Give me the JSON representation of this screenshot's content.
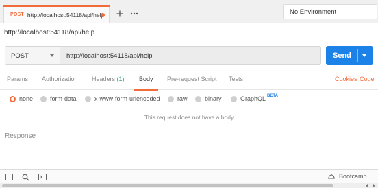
{
  "request_tab": {
    "method": "POST",
    "url": "http://localhost:54118/api/help",
    "unsaved_color": "#f26b3a"
  },
  "tab_actions": {
    "add_icon": "plus-icon",
    "more_icon": "ellipsis-icon"
  },
  "environment": {
    "selected": "No Environment"
  },
  "request": {
    "title": "http://localhost:54118/api/help",
    "method": "POST",
    "url": "http://localhost:54118/api/help",
    "send_label": "Send"
  },
  "request_tabs": {
    "params": "Params",
    "authorization": "Authorization",
    "headers": "Headers",
    "headers_count": "(1)",
    "body": "Body",
    "prerequest": "Pre-request Script",
    "tests": "Tests",
    "cookies": "Cookies",
    "code": "Code",
    "active": "Body"
  },
  "body_types": {
    "none": "none",
    "form_data": "form-data",
    "urlencoded": "x-www-form-urlencoded",
    "raw": "raw",
    "binary": "binary",
    "graphql": "GraphQL",
    "graphql_badge": "BETA",
    "selected": "none"
  },
  "body_message": "This request does not have a body",
  "response": {
    "label": "Response"
  },
  "statusbar": {
    "icons": [
      "sidebar-icon",
      "search-icon",
      "console-icon"
    ],
    "bootcamp_label": "Bootcamp"
  },
  "colors": {
    "accent": "#f26b3a",
    "send": "#1d82e8",
    "success": "#2aaa6c"
  }
}
